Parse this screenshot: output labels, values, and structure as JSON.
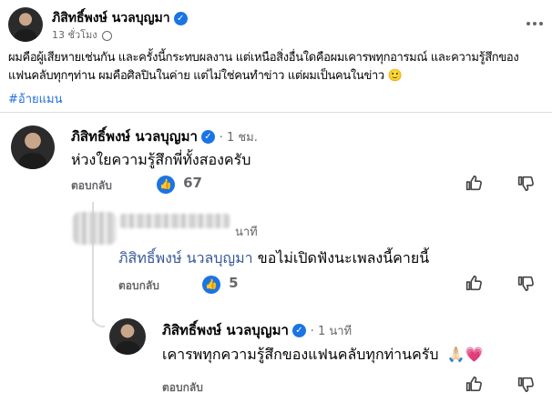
{
  "post": {
    "author": "ภิสิทธิ์พงษ์ นวลบุญมา",
    "time": "13 ชั่วโมง",
    "text_line1": "ผมคือผู้เสียหายเช่นกัน และครั้งนี้กระทบผลงาน แต่เหนือสิ่งอื่นใดคือผมเคารพทุกอารมณ์ และความรู้สึกของ",
    "text_line2": "แฟนคลับทุกๆท่าน ผมคือศิลปินในค่าย แต่ไม่ใช่คนทำข่าว แต่ผมเป็นคนในข่าว",
    "emoji": "🙂",
    "hashtag": "#อ้ายแมน",
    "more_icon": "more-horizontal-icon"
  },
  "comments": [
    {
      "author": "ภิสิทธิ์พงษ์ นวลบุญมา",
      "time": "1 ชม.",
      "text": "ห่วงใยความรู้สึกพี่ทั้งสองครับ",
      "reply_label": "ตอบกลับ",
      "likes": "67"
    },
    {
      "author_suffix": "นาที",
      "mention": "ภิสิทธิ์พงษ์ นวลบุญมา",
      "text": "ขอไม่เปิดฟังนะเพลงนี้คายนี้",
      "reply_label": "ตอบกลับ",
      "likes": "5"
    },
    {
      "author": "ภิสิทธิ์พงษ์ นวลบุญมา",
      "time": "1 นาที",
      "text": "เคารพทุกความรู้สึกของแฟนคลับทุกท่านครับ",
      "emoji": "🙏🏻💗",
      "reply_label": "ตอบกลับ"
    }
  ],
  "icons": {
    "verified": "✓",
    "like": "👍",
    "globe": "🌐"
  },
  "colors": {
    "verified_blue": "#1b74e4",
    "mention": "#385898",
    "hashtag": "#216fdb"
  }
}
